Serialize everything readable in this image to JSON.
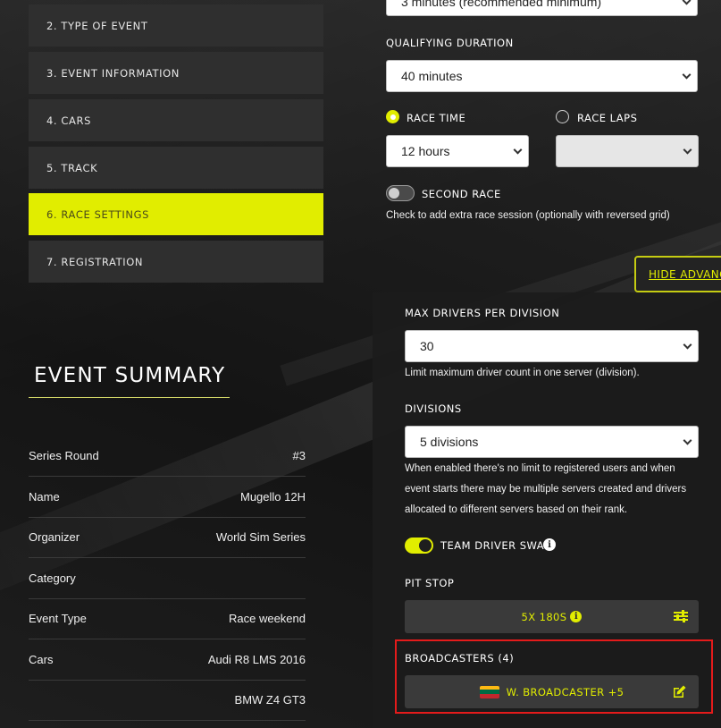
{
  "nav": {
    "items": [
      {
        "label": "2. TYPE OF EVENT",
        "active": false
      },
      {
        "label": "3. EVENT INFORMATION",
        "active": false
      },
      {
        "label": "4. CARS",
        "active": false
      },
      {
        "label": "5. TRACK",
        "active": false
      },
      {
        "label": "6. RACE SETTINGS",
        "active": true
      },
      {
        "label": "7. REGISTRATION",
        "active": false
      }
    ]
  },
  "summary": {
    "title": "EVENT SUMMARY",
    "rows": [
      {
        "label": "Series Round",
        "value": "#3"
      },
      {
        "label": "Name",
        "value": "Mugello 12H"
      },
      {
        "label": "Organizer",
        "value": "World Sim Series"
      },
      {
        "label": "Category",
        "value": ""
      },
      {
        "label": "Event Type",
        "value": "Race weekend"
      },
      {
        "label": "Cars",
        "value": "Audi R8 LMS 2016"
      },
      {
        "label": "",
        "value": "BMW Z4 GT3"
      }
    ]
  },
  "settings": {
    "practice_duration": "3 minutes (recommended minimum)",
    "qualifying_label": "QUALIFYING DURATION",
    "qualifying_value": "40 minutes",
    "race_time_label": "RACE TIME",
    "race_time_selected": true,
    "race_laps_label": "RACE LAPS",
    "race_laps_selected": false,
    "race_time_value": "12 hours",
    "race_laps_value": "",
    "second_race_label": "SECOND RACE",
    "second_race_on": false,
    "second_race_hint": "Check to add extra race session (optionally with reversed grid)"
  },
  "advanced": {
    "toggle_label": "HIDE ADVANCED",
    "max_drivers_label": "MAX DRIVERS PER DIVISION",
    "max_drivers_value": "30",
    "max_drivers_hint": "Limit maximum driver count in one server (division).",
    "divisions_label": "DIVISIONS",
    "divisions_value": "5 divisions",
    "divisions_hint_1": "When enabled there's no limit to registered users and when",
    "divisions_hint_2": "event starts there may be multiple servers created and drivers",
    "divisions_hint_3": "allocated to different servers based on their rank.",
    "team_swap_label": "TEAM DRIVER SWAP",
    "team_swap_on": true,
    "pit_stop_label": "PIT STOP",
    "pit_stop_value": "5X 180S",
    "broadcasters_label": "BROADCASTERS (4)",
    "broadcaster_value": "W. BROADCASTER +5"
  },
  "colors": {
    "accent": "#e1ed00",
    "highlight_box": "#e41b1b",
    "panel": "#2f2f2f"
  }
}
